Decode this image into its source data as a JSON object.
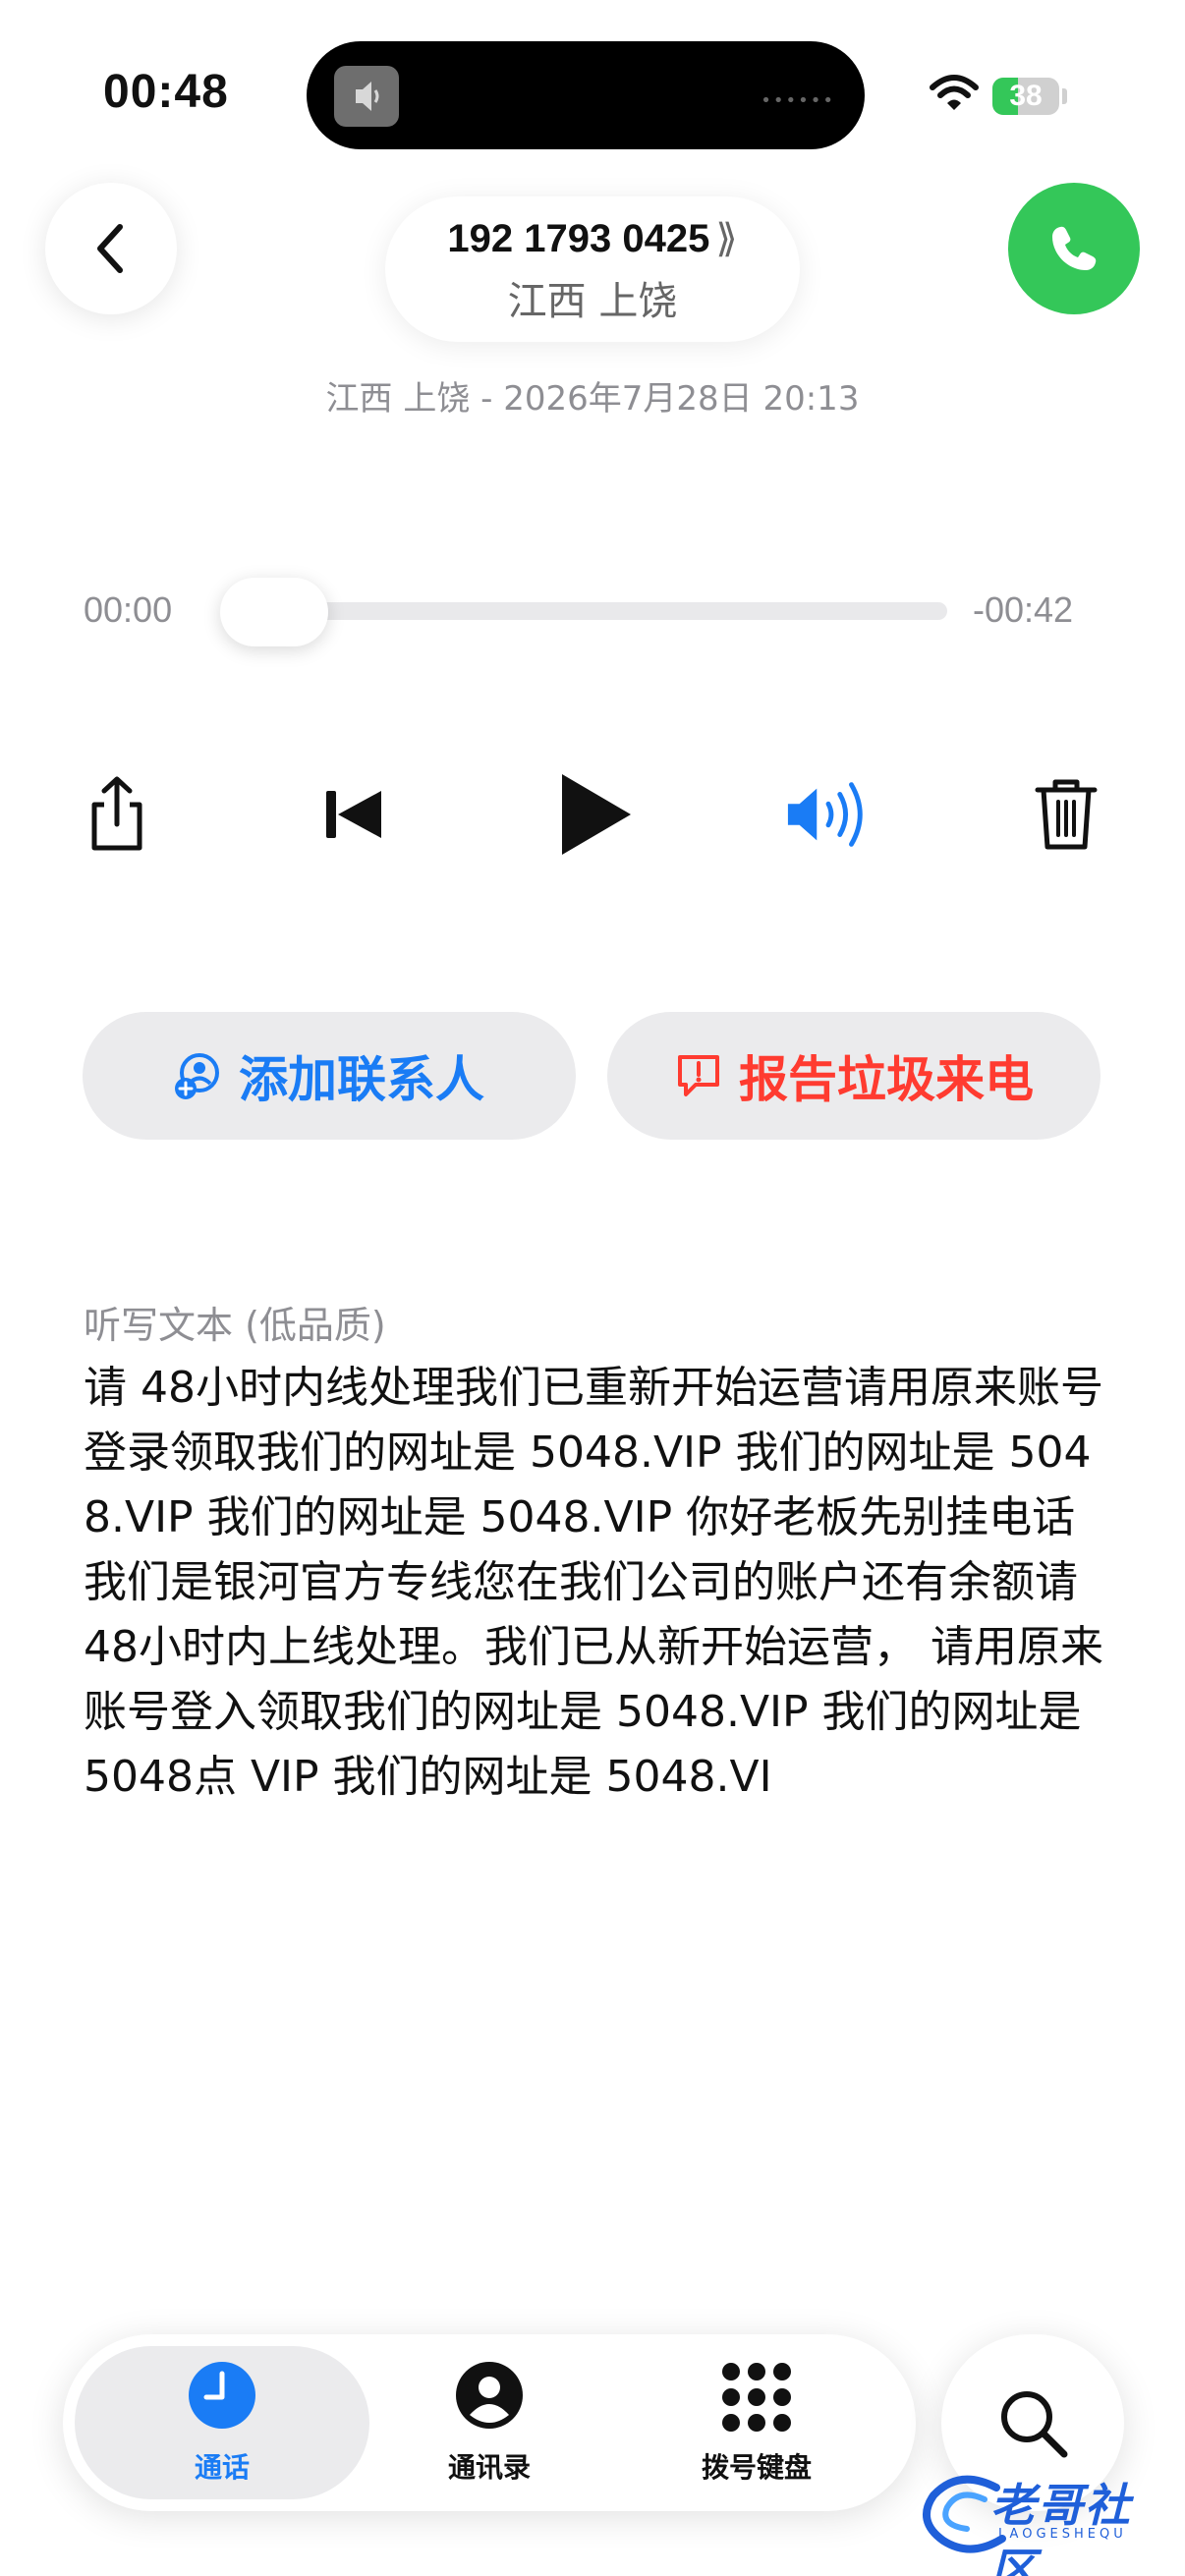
{
  "status_bar": {
    "time": "00:48",
    "battery_level": "38",
    "battery_fraction": 0.38
  },
  "header": {
    "phone_number": "192 1793 0425",
    "number_chevron": "⟫",
    "location": "江西 上饶",
    "call_info": "江西 上饶 - 2026年7月28日 20:13"
  },
  "player": {
    "elapsed": "00:00",
    "remaining": "-00:42",
    "progress": 0.0
  },
  "controls": {
    "share_icon": "share-icon",
    "skip_back_icon": "skip-back-icon",
    "play_icon": "play-icon",
    "speaker_icon": "speaker-icon",
    "trash_icon": "trash-icon"
  },
  "actions": {
    "add_contact": "添加联系人",
    "report_spam": "报告垃圾来电"
  },
  "transcript": {
    "label": "听写文本 (低品质)",
    "text": "请 48小时内线处理我们已重新开始运营请用原来账号登录领取我们的网址是 5048.VIP 我们的网址是 5048.VIP 我们的网址是 5048.VIP 你好老板先别挂电话 我们是银河官方专线您在我们公司的账户还有余额请 48小时内上线处理。我们已从新开始运营， 请用原来账号登入领取我们的网址是 5048.VIP 我们的网址是 5048点 VIP 我们的网址是 5048.VI"
  },
  "tab_bar": {
    "tabs": [
      {
        "label": "通话",
        "icon": "clock-icon",
        "active": true
      },
      {
        "label": "通讯录",
        "icon": "contacts-icon",
        "active": false
      },
      {
        "label": "拨号键盘",
        "icon": "keypad-icon",
        "active": false
      }
    ],
    "search_icon": "search-icon"
  },
  "colors": {
    "accent_blue": "#1a7cf5",
    "call_green": "#34c759",
    "spam_red": "#ff3b30",
    "secondary_gray": "#8e8e93"
  },
  "watermark": {
    "title": "老哥社区",
    "subtitle": "LAOGESHEQU"
  }
}
